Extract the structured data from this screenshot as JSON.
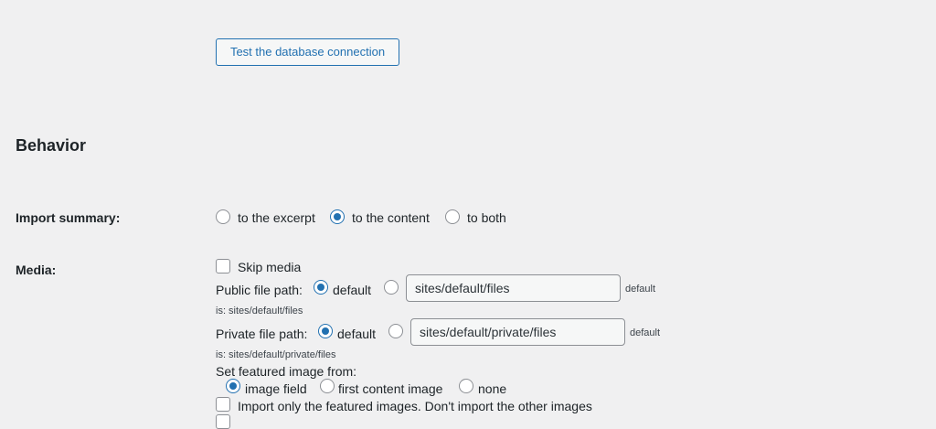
{
  "connection": {
    "test_button_label": "Test the database connection"
  },
  "behavior": {
    "section_title": "Behavior",
    "import_summary": {
      "label": "Import summary:",
      "options": [
        "to the excerpt",
        "to the content",
        "to both"
      ],
      "selected": "to the content"
    },
    "media": {
      "label": "Media:",
      "skip_media_label": "Skip media",
      "public_file_path": {
        "label": "Public file path:",
        "default_option_label": "default",
        "selected": "default",
        "value": "sites/default/files",
        "hint_prefix": "default",
        "hint_rest": "is: sites/default/files"
      },
      "private_file_path": {
        "label": "Private file path:",
        "default_option_label": "default",
        "selected": "default",
        "value": "sites/default/private/files",
        "hint_prefix": "default",
        "hint_rest": "is: sites/default/private/files"
      },
      "featured_image": {
        "label": "Set featured image from:",
        "options": [
          "image field",
          "first content image",
          "none"
        ],
        "selected": "image field"
      },
      "only_featured_label": "Import only the featured images. Don't import the other images"
    }
  },
  "colors": {
    "background": "#f0f0f1",
    "accent": "#2271b1",
    "text": "#1d2327",
    "border": "#8c8f94"
  }
}
